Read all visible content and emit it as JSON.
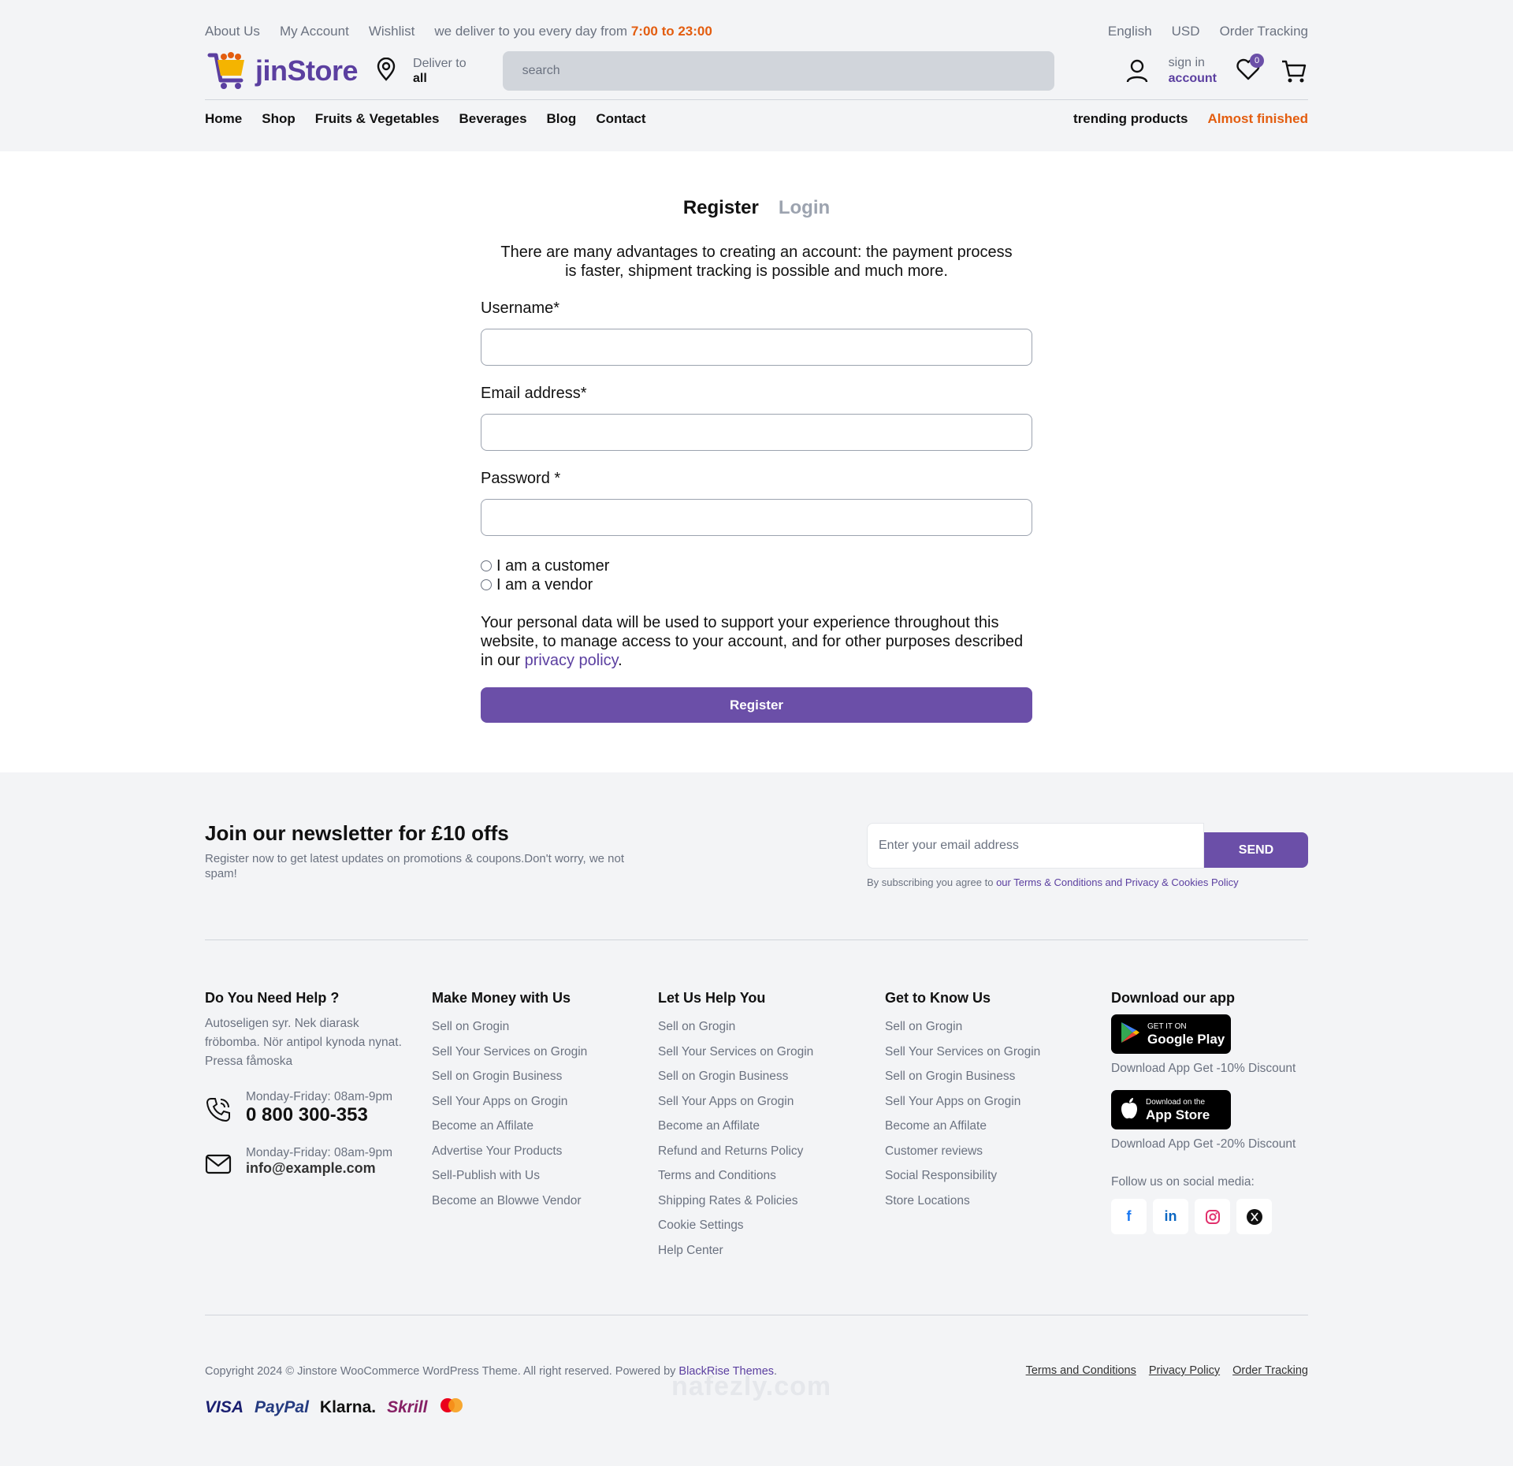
{
  "topbar": {
    "links": [
      "About Us",
      "My Account",
      "Wishlist"
    ],
    "delivery_text": "we deliver to you every day from",
    "delivery_hours": "7:00 to 23:00",
    "right_links": [
      "English",
      "USD",
      "Order Tracking"
    ]
  },
  "header": {
    "logo_text": "jinStore",
    "deliver_label": "Deliver to",
    "deliver_value": "all",
    "search_placeholder": "search",
    "signin_label": "sign in",
    "account_label": "account",
    "wishlist_count": "0"
  },
  "nav": {
    "items": [
      "Home",
      "Shop",
      "Fruits & Vegetables",
      "Beverages",
      "Blog",
      "Contact"
    ],
    "trending": "trending products",
    "almost": "Almost finished"
  },
  "auth": {
    "tab_register": "Register",
    "tab_login": "Login",
    "intro_line1": "There are many advantages to creating an account: the payment process",
    "intro_line2": "is faster, shipment tracking is possible and much more.",
    "username_label": "Username*",
    "email_label": "Email address*",
    "password_label": "Password *",
    "radio_customer": "I am a customer",
    "radio_vendor": "I am a vendor",
    "privacy_text": "Your personal data will be used to support your experience throughout this website, to manage access to your account, and for other purposes described in our",
    "privacy_link": "privacy policy",
    "privacy_end": ".",
    "register_button": "Register"
  },
  "newsletter": {
    "title": "Join our newsletter for £10 offs",
    "subtitle": "Register now to get latest updates on promotions & coupons.Don't worry, we not spam!",
    "email_placeholder": "Enter your email address",
    "send_button": "SEND",
    "note_prefix": "By subscribing you agree to",
    "note_link": "our Terms & Conditions and Privacy & Cookies Policy"
  },
  "footer": {
    "help": {
      "title": "Do You Need Help ?",
      "text": "Autoseligen syr. Nek diarask fröbomba. Nör antipol kynoda nynat. Pressa fåmoska",
      "phone_hours": "Monday-Friday: 08am-9pm",
      "phone": "0 800 300-353",
      "email_hours": "Monday-Friday: 08am-9pm",
      "email": "info@example.com"
    },
    "money": {
      "title": "Make Money with Us",
      "links": [
        "Sell on Grogin",
        "Sell Your Services on Grogin",
        "Sell on Grogin Business",
        "Sell Your Apps on Grogin",
        "Become an Affilate",
        "Advertise Your Products",
        "Sell-Publish with Us",
        "Become an Blowwe Vendor"
      ]
    },
    "helpyou": {
      "title": "Let Us Help You",
      "links": [
        "Sell on Grogin",
        "Sell Your Services on Grogin",
        "Sell on Grogin Business",
        "Sell Your Apps on Grogin",
        "Become an Affilate",
        "Refund and Returns Policy",
        "Terms and Conditions",
        "Shipping Rates & Policies",
        "Cookie Settings",
        "Help Center"
      ]
    },
    "know": {
      "title": "Get to Know Us",
      "links": [
        "Sell on Grogin",
        "Sell Your Services on Grogin",
        "Sell on Grogin Business",
        "Sell Your Apps on Grogin",
        "Become an Affilate",
        "Customer reviews",
        "Social Responsibility",
        "Store Locations"
      ]
    },
    "app": {
      "title": "Download our app",
      "google_small": "GET IT ON",
      "google_big": "Google Play",
      "google_note": "Download App Get -10% Discount",
      "apple_small": "Download on the",
      "apple_big": "App Store",
      "apple_note": "Download App Get -20% Discount",
      "follow": "Follow us on social media:",
      "social_icons": [
        "facebook-icon",
        "linkedin-icon",
        "instagram-icon",
        "x-icon"
      ]
    },
    "copyright_text": "Copyright 2024 © Jinstore WooCommerce WordPress Theme. All right reserved. Powered by",
    "copyright_link": "BlackRise Themes",
    "legal_links": [
      "Terms and Conditions",
      "Privacy Policy",
      "Order Tracking"
    ],
    "payments": [
      "VISA",
      "PayPal",
      "Klarna.",
      "Skrill"
    ]
  },
  "watermark": "nafezly.com",
  "colors": {
    "brand": "#6b4fa8",
    "accent_orange": "#e35d0f",
    "background": "#f3f4f6"
  }
}
